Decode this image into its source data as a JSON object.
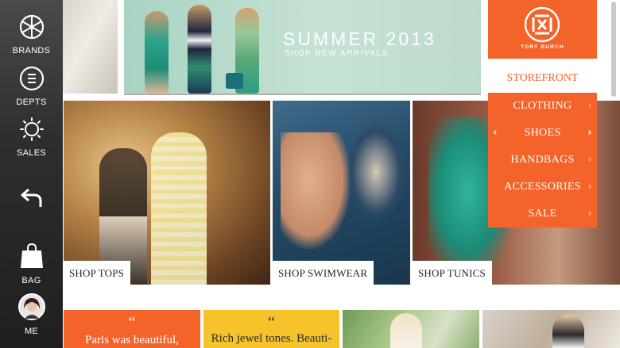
{
  "sidebar": {
    "items": [
      {
        "label": "BRANDS",
        "icon": "brands-wheel-icon"
      },
      {
        "label": "DEPTS",
        "icon": "depts-list-icon"
      },
      {
        "label": "SALES",
        "icon": "sales-sun-icon"
      },
      {
        "label": "",
        "icon": "back-arrow-icon"
      },
      {
        "label": "BAG",
        "icon": "shopping-bag-icon"
      },
      {
        "label": "ME",
        "icon": "profile-avatar"
      }
    ]
  },
  "banner": {
    "title": "SUMMER 2013",
    "subtitle": "SHOP NEW ARRIVALS"
  },
  "brand_menu": {
    "brand": "TORY BURCH",
    "storefront": "STOREFRONT",
    "items": [
      {
        "label": "CLOTHING"
      },
      {
        "label": "SHOES",
        "active": true
      },
      {
        "label": "HANDBAGS"
      },
      {
        "label": "ACCESSORIES"
      },
      {
        "label": "SALE"
      }
    ],
    "accent_color": "#f4632a"
  },
  "tiles": [
    {
      "label": "SHOP TOPS"
    },
    {
      "label": "SHOP SWIMWEAR"
    },
    {
      "label": "SHOP TUNICS"
    }
  ],
  "quotes": [
    {
      "mark": "“",
      "text": "Paris was beautiful,"
    },
    {
      "mark": "“",
      "text": "Rich jewel tones. Beauti-"
    }
  ]
}
